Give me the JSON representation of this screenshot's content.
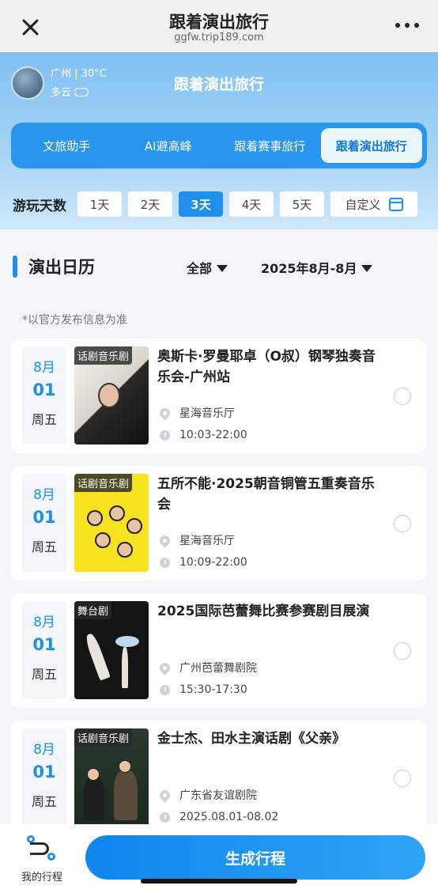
{
  "nav": {
    "title": "跟着演出旅行",
    "url": "ggfw.trip189.com"
  },
  "weather": {
    "city": "广州 | 30°C",
    "condition": "多云"
  },
  "hero": {
    "title": "跟着演出旅行"
  },
  "tabs": [
    {
      "label": "文旅助手"
    },
    {
      "label": "AI避高峰"
    },
    {
      "label": "跟着赛事旅行"
    },
    {
      "label": "跟着演出旅行",
      "active": true
    }
  ],
  "days": {
    "label": "游玩天数",
    "options": [
      "1天",
      "2天",
      "3天",
      "4天",
      "5天"
    ],
    "selected": "3天",
    "custom": "自定义"
  },
  "calendar": {
    "title": "演出日历",
    "filter_all": "全部",
    "filter_month": "2025年8月-8月",
    "note": "*以官方发布信息为准"
  },
  "events": [
    {
      "month": "8月",
      "day": "01",
      "weekday": "周五",
      "tag": "话剧音乐剧",
      "title": "奥斯卡·罗曼耶卓（O叔）钢琴独奏音乐会-广州站",
      "venue": "星海音乐厅",
      "time": "10:03-22:00"
    },
    {
      "month": "8月",
      "day": "01",
      "weekday": "周五",
      "tag": "话剧音乐剧",
      "title": "五所不能·2025朝音铜管五重奏音乐会",
      "venue": "星海音乐厅",
      "time": "10:09-22:00"
    },
    {
      "month": "8月",
      "day": "01",
      "weekday": "周五",
      "tag": "舞台剧",
      "title": "2025国际芭蕾舞比赛参赛剧目展演",
      "venue": "广州芭蕾舞剧院",
      "time": "15:30-17:30"
    },
    {
      "month": "8月",
      "day": "01",
      "weekday": "周五",
      "tag": "话剧音乐剧",
      "title": "金士杰、田水主演话剧《父亲》",
      "venue": "广东省友谊剧院",
      "time": "2025.08.01-08.02"
    }
  ],
  "bottom": {
    "trip_label": "我的行程",
    "generate_label": "生成行程"
  },
  "colors": {
    "accent": "#1e8fea",
    "tab_bar": "#2a95ef"
  }
}
